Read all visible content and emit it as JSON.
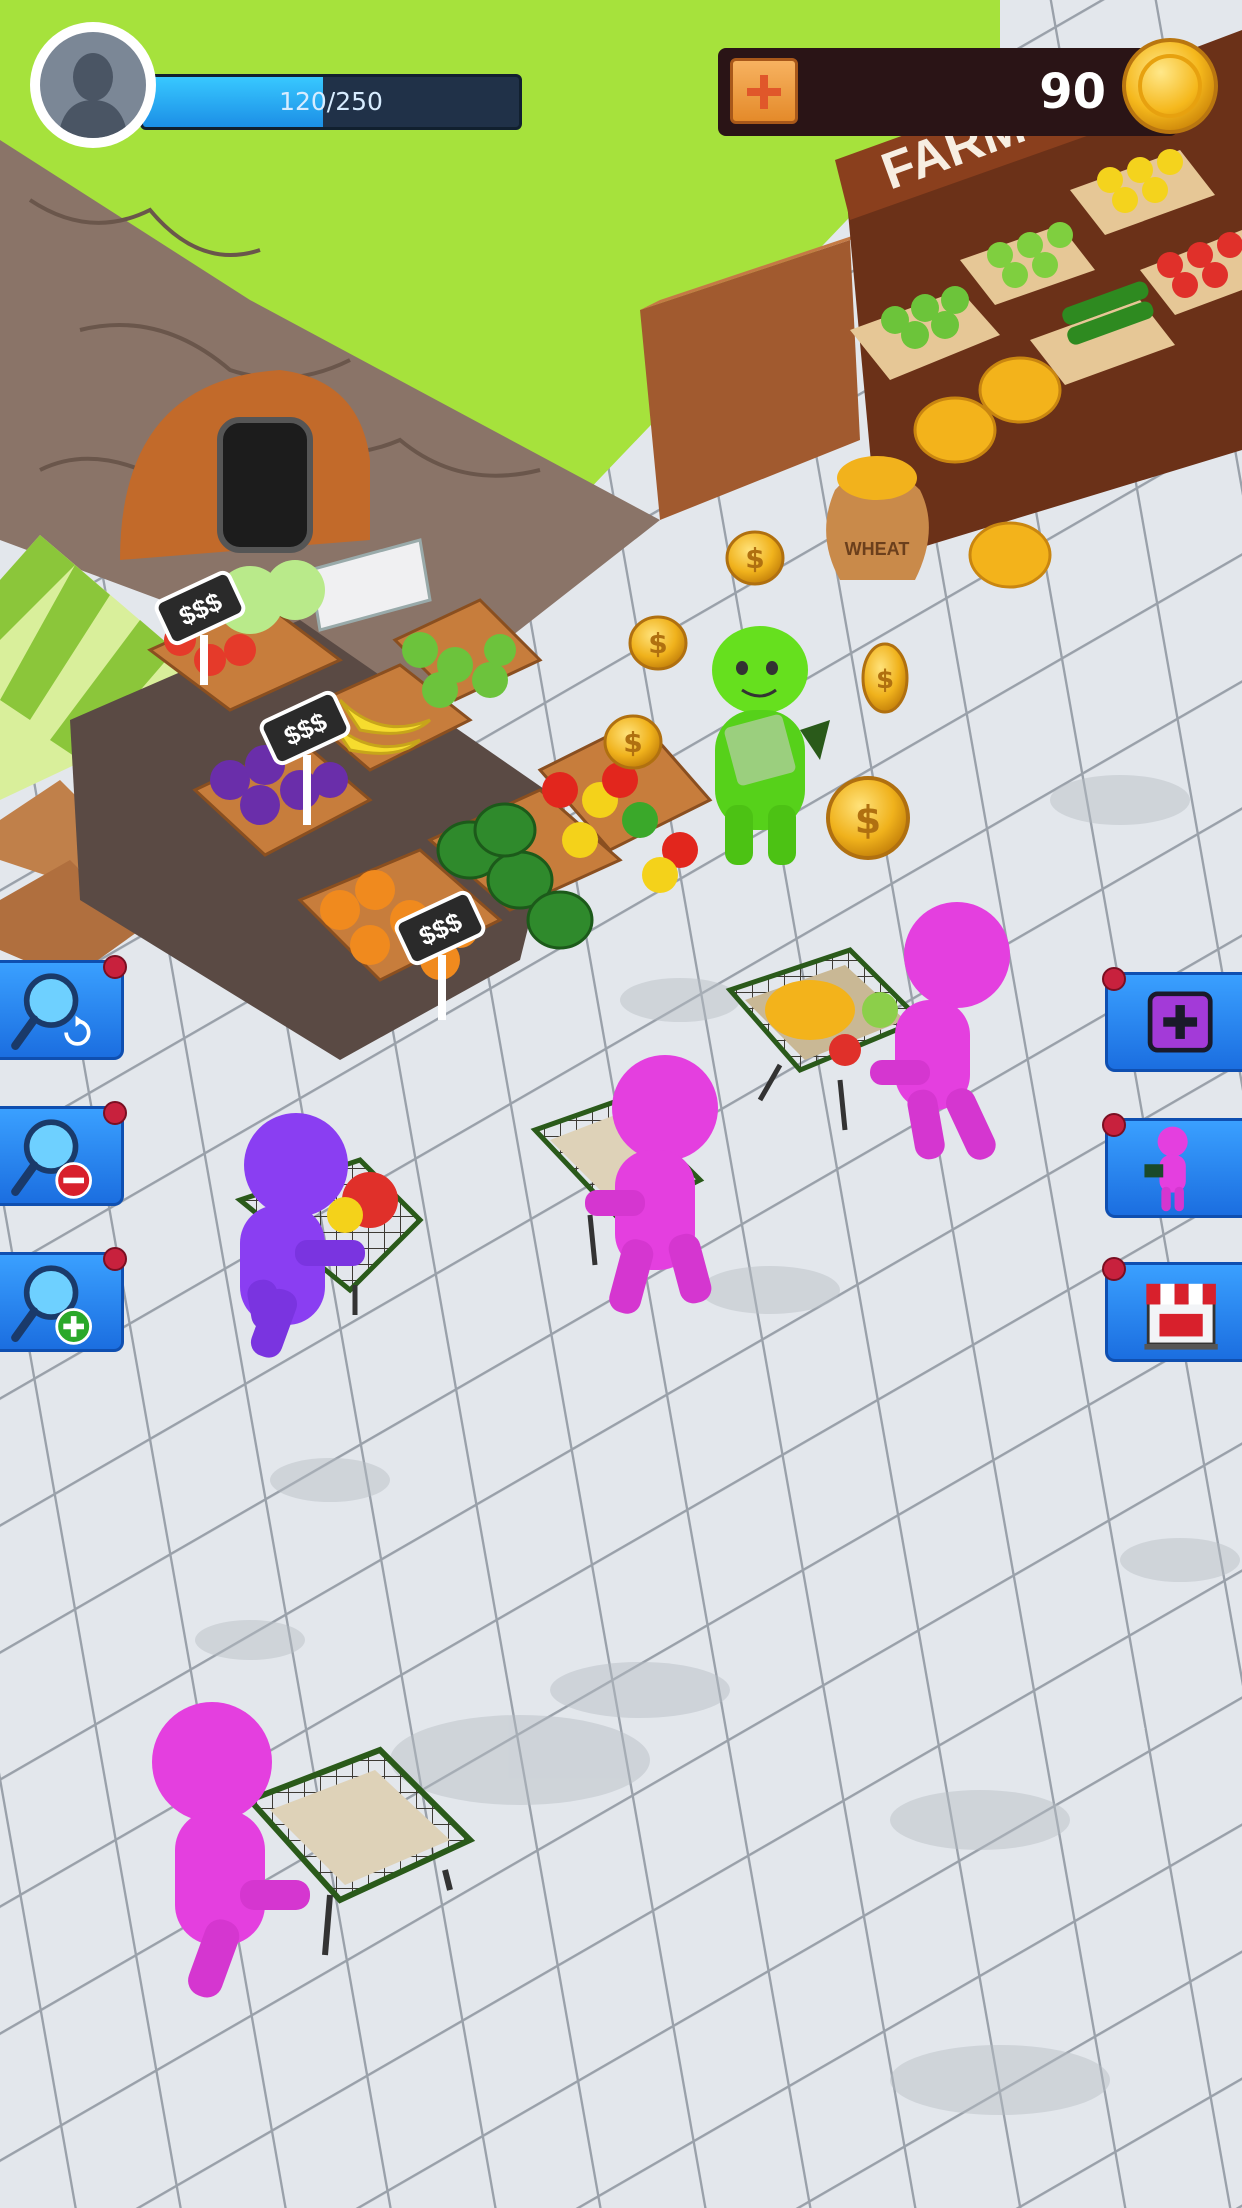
{
  "hud": {
    "xp_text": "120/250",
    "xp_progress": 0.48,
    "coins": "90",
    "avatar_icon": "player-avatar-silhouette-icon",
    "add_coins_icon": "plus-icon",
    "coin_icon": "gold-coin-icon"
  },
  "scene": {
    "stand_sign": "FARM FOOD",
    "wheat_label": "WHEAT",
    "price_tag": "$$$"
  },
  "left_tools": [
    {
      "name": "magnifier-reset-button",
      "icon": "magnifier-refresh-icon"
    },
    {
      "name": "zoom-out-button",
      "icon": "magnifier-minus-icon"
    },
    {
      "name": "zoom-in-button",
      "icon": "magnifier-plus-icon"
    }
  ],
  "right_tools": [
    {
      "name": "add-button",
      "icon": "purple-plus-icon"
    },
    {
      "name": "hire-customer-button",
      "icon": "pink-stickman-icon"
    },
    {
      "name": "shop-button",
      "icon": "storefront-icon"
    }
  ],
  "colors": {
    "grass": "#a5e23a",
    "tile": "#dfe4ea",
    "button_blue": "#2a8af0",
    "customer_pink": "#e63de0",
    "customer_purple": "#8a3ef0",
    "cashier_green": "#56d91a"
  }
}
